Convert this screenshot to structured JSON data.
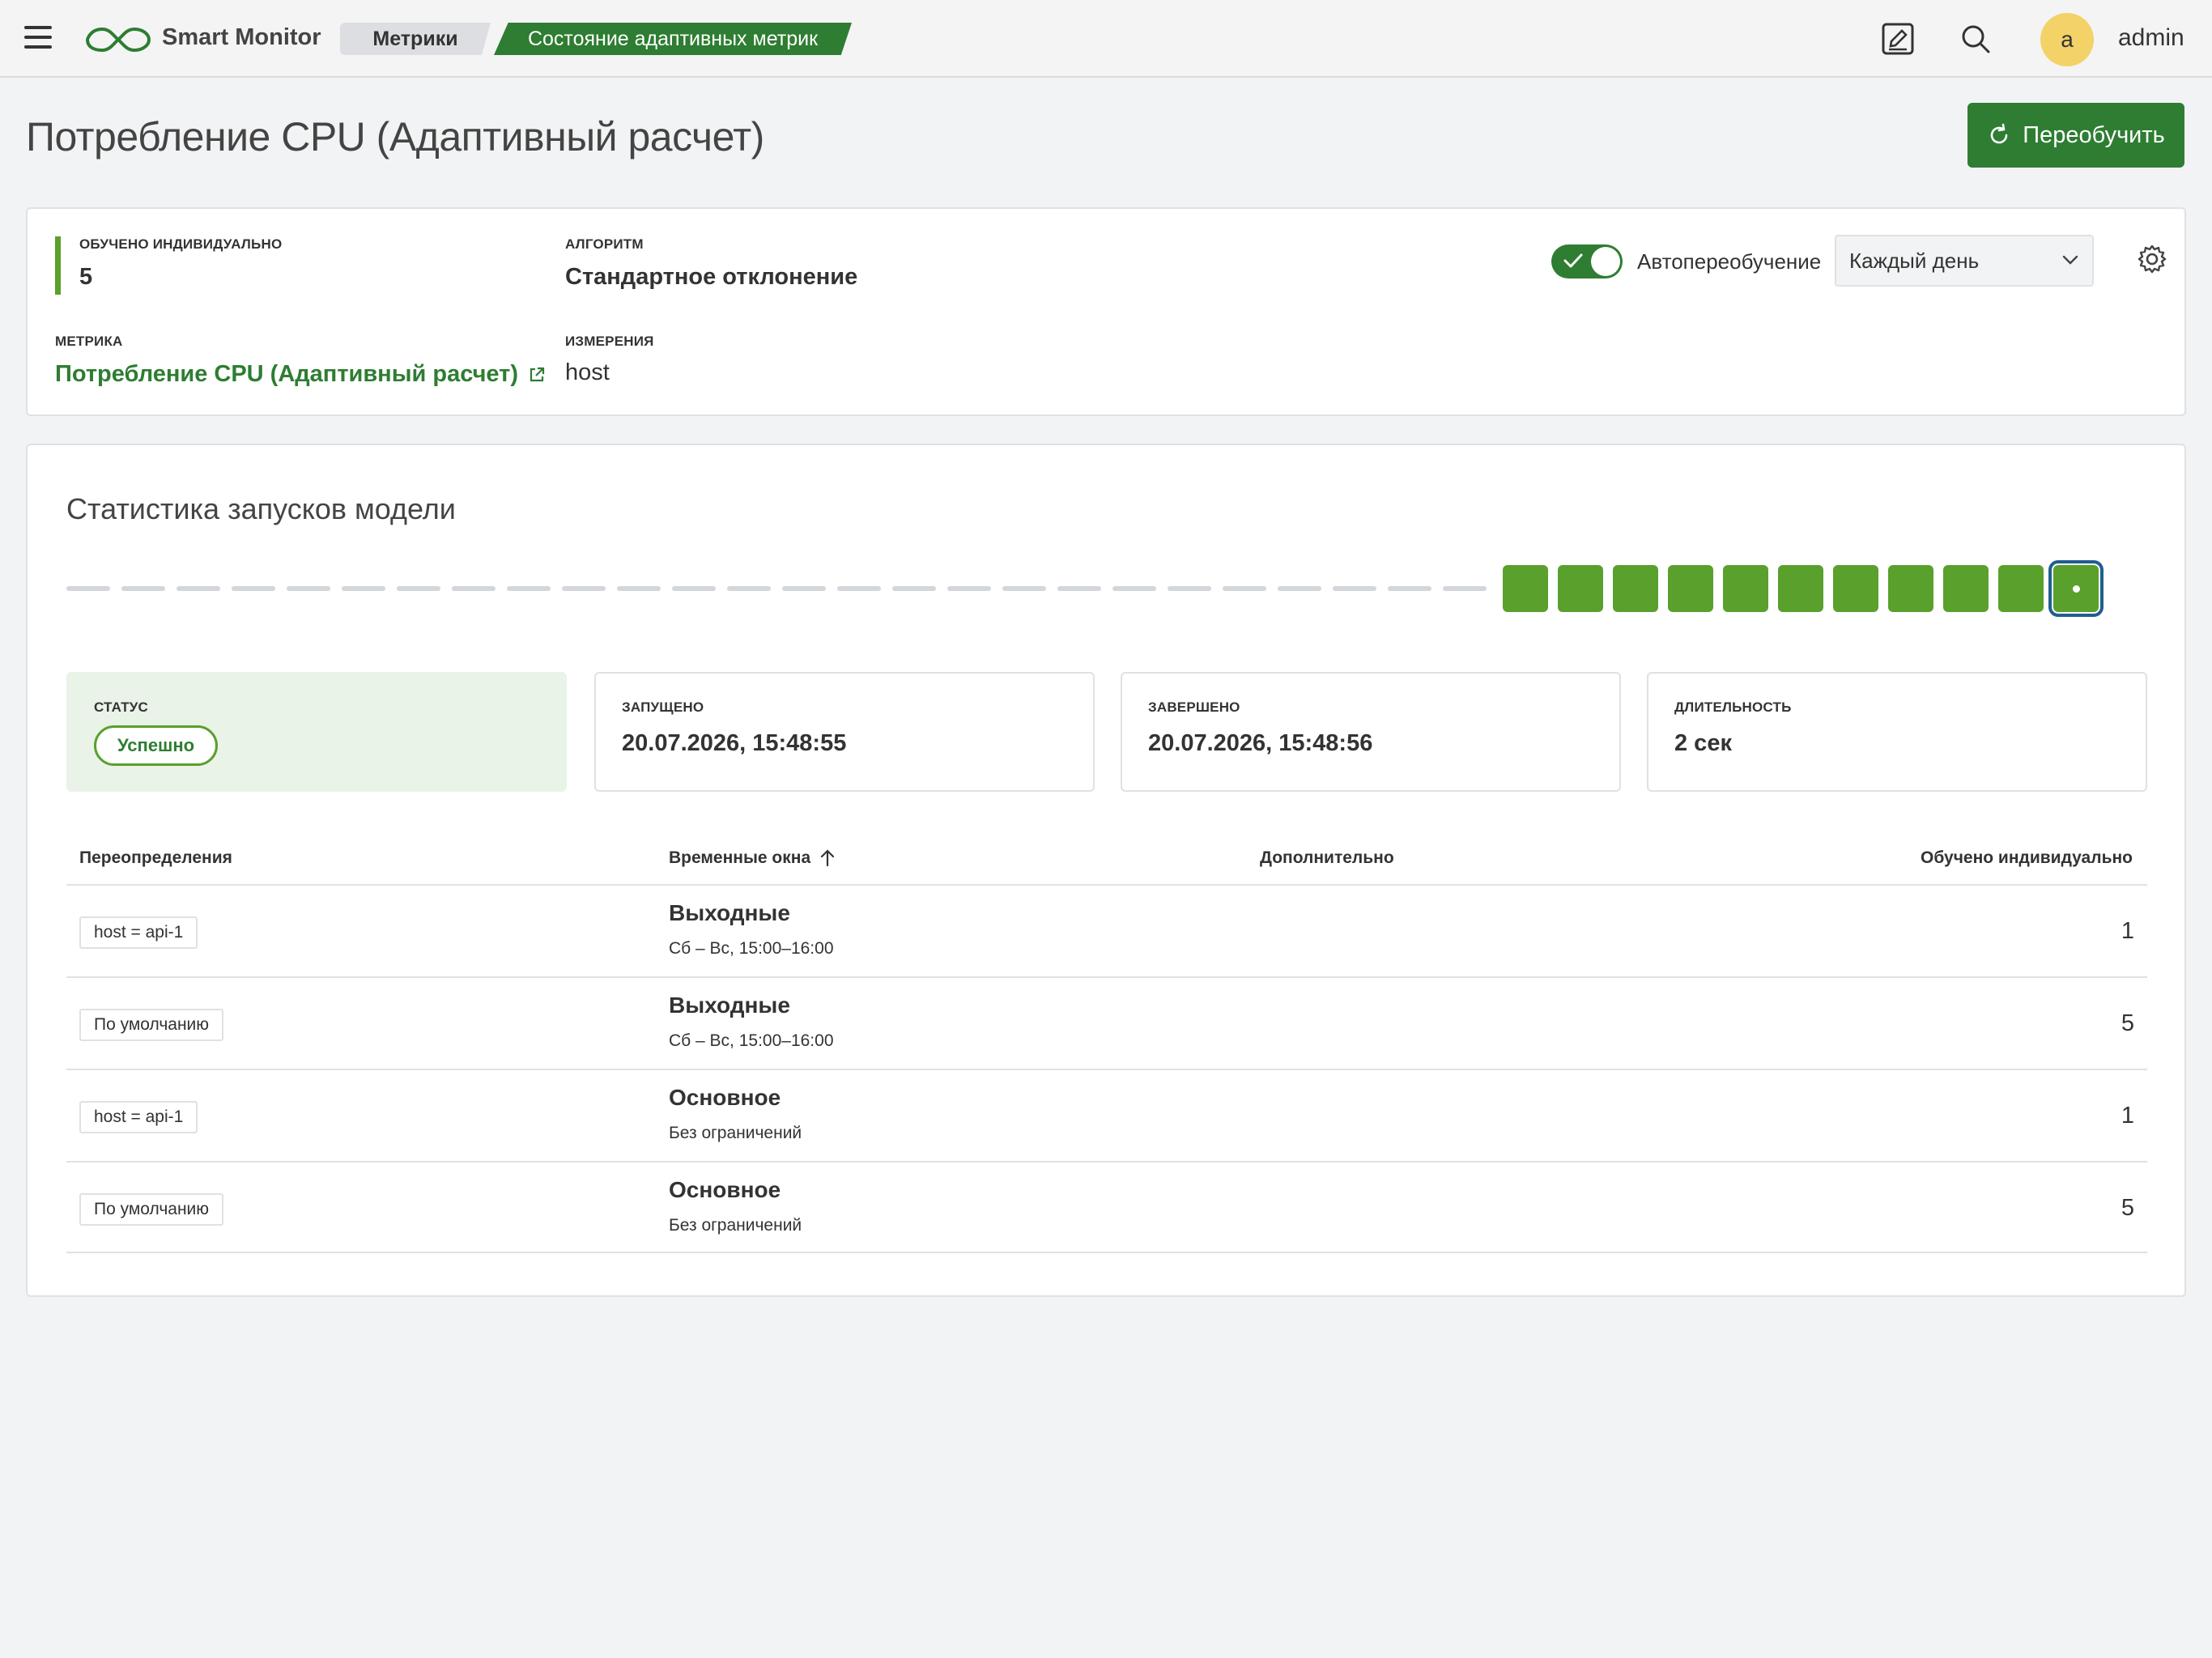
{
  "header": {
    "app_name": "Smart Monitor",
    "breadcrumbs": [
      "Метрики",
      "Состояние адаптивных метрик"
    ],
    "avatar_letter": "a",
    "username": "admin"
  },
  "page": {
    "title": "Потребление CPU (Адаптивный расчет)",
    "retrain_label": "Переобучить"
  },
  "info": {
    "trained_label": "ОБУЧЕНО ИНДИВИДУАЛЬНО",
    "trained_value": "5",
    "algorithm_label": "АЛГОРИТМ",
    "algorithm_value": "Стандартное отклонение",
    "metric_label": "МЕТРИКА",
    "metric_value": "Потребление CPU (Адаптивный расчет)",
    "dimensions_label": "ИЗМЕРЕНИЯ",
    "dimensions_value": "host",
    "auto_retrain_label": "Автопереобучение",
    "auto_retrain_enabled": true,
    "schedule_value": "Каждый день"
  },
  "stats": {
    "title": "Статистика запусков модели",
    "empty_slots": 26,
    "successful_runs": 11,
    "selected_run_index": 10,
    "status_label": "СТАТУС",
    "status_value": "Успешно",
    "started_label": "ЗАПУЩЕНО",
    "started_value": "20.07.2026, 15:48:55",
    "finished_label": "ЗАВЕРШЕНО",
    "finished_value": "20.07.2026, 15:48:56",
    "duration_label": "ДЛИТЕЛЬНОСТЬ",
    "duration_value": "2 сек"
  },
  "table": {
    "columns": [
      "Переопределения",
      "Временные окна",
      "Дополнительно",
      "Обучено индивидуально"
    ],
    "rows": [
      {
        "override": "host = api-1",
        "window": "Выходные",
        "window_desc": "Сб – Вс, 15:00–16:00",
        "count": "1"
      },
      {
        "override": "По умолчанию",
        "window": "Выходные",
        "window_desc": "Сб – Вс, 15:00–16:00",
        "count": "5"
      },
      {
        "override": "host = api-1",
        "window": "Основное",
        "window_desc": "Без ограничений",
        "count": "1"
      },
      {
        "override": "По умолчанию",
        "window": "Основное",
        "window_desc": "Без ограничений",
        "count": "5"
      }
    ]
  },
  "colors": {
    "brand_green": "#2e7d32",
    "run_green": "#5aa02c",
    "selected_outline": "#1f5f8f",
    "avatar": "#f3d267"
  }
}
